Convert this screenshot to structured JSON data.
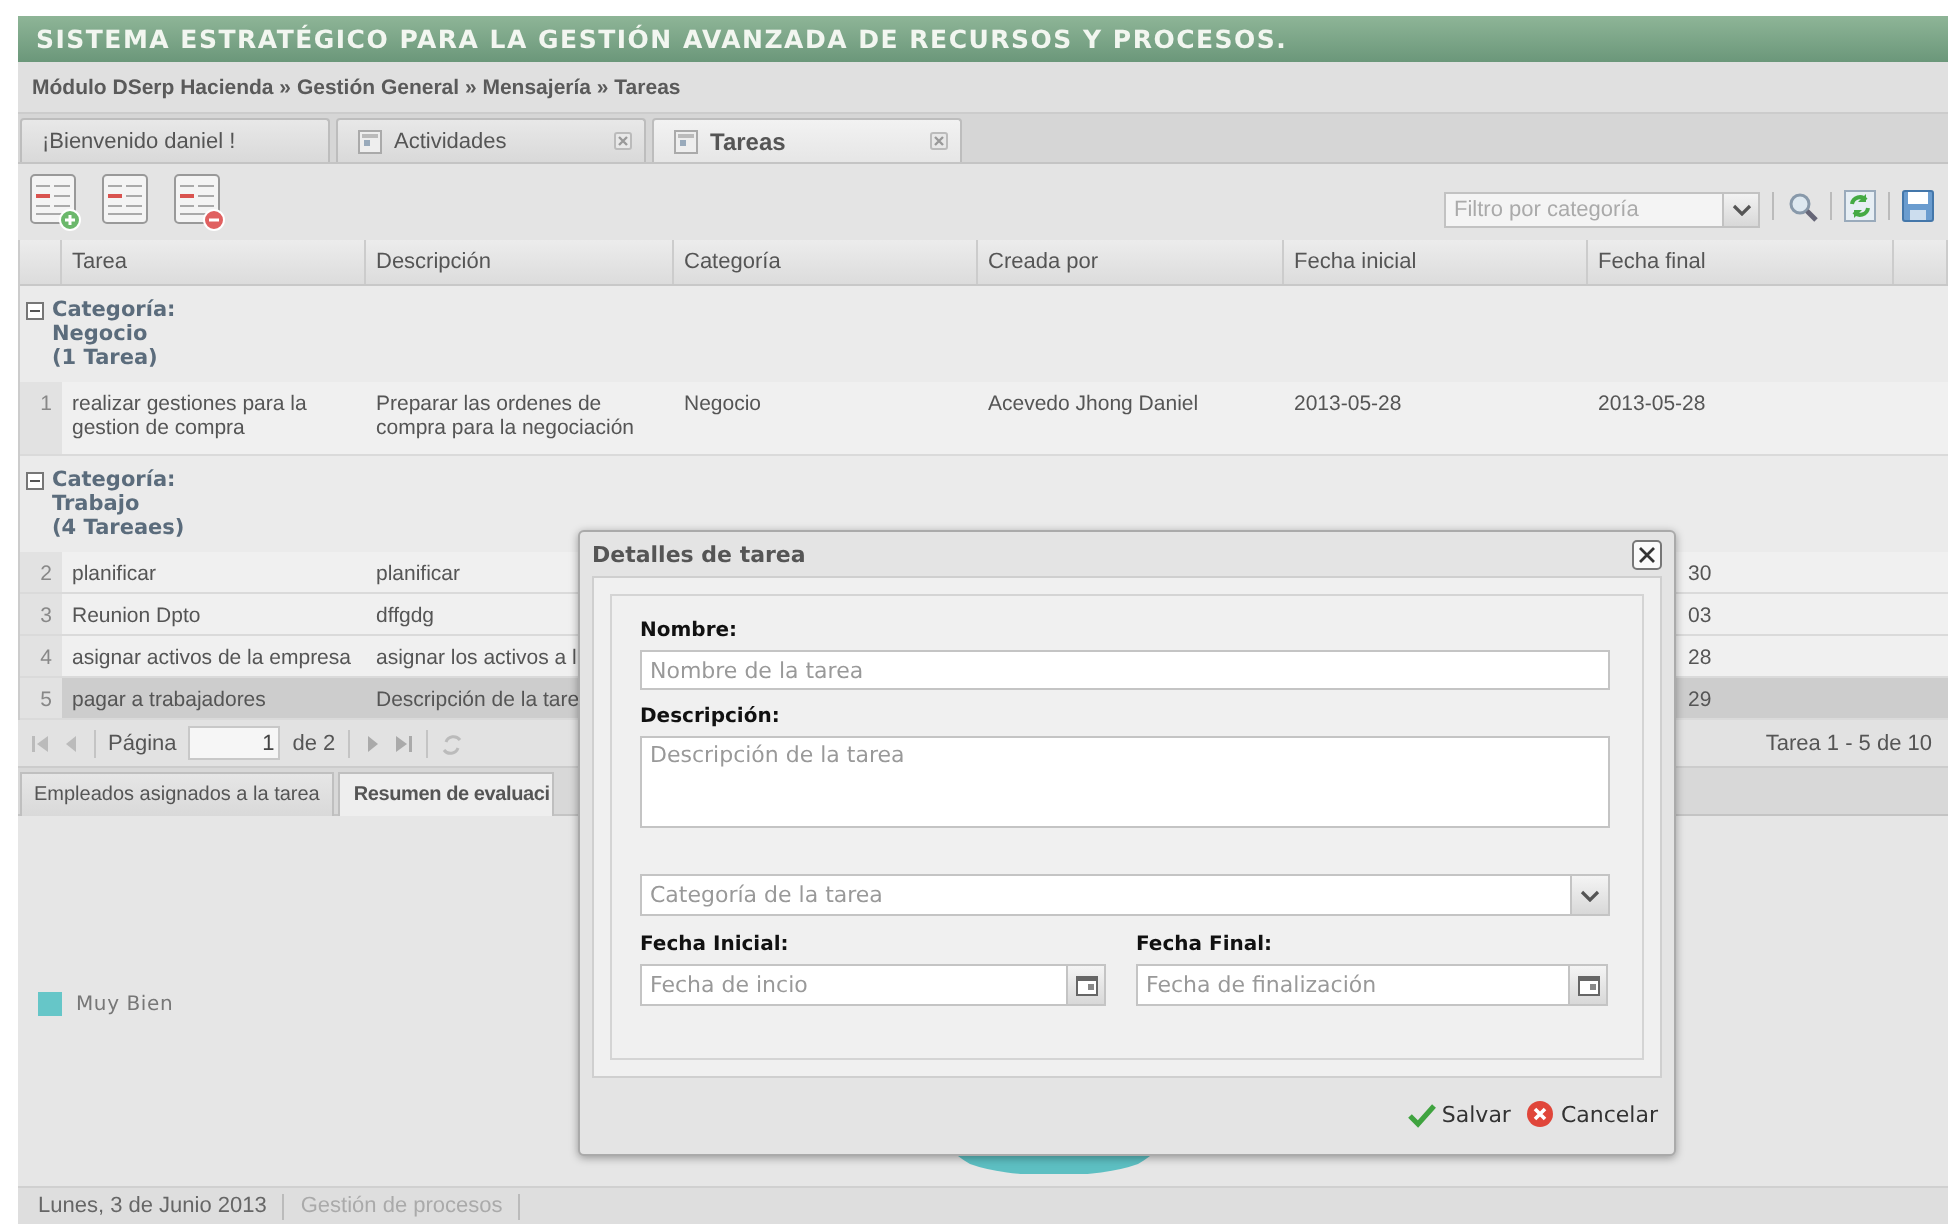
{
  "header": {
    "title": "SISTEMA ESTRATÉGICO PARA LA GESTIÓN AVANZADA DE RECURSOS Y PROCESOS."
  },
  "breadcrumb": "Módulo DSerp Hacienda » Gestión General » Mensajería » Tareas",
  "tabs": [
    {
      "label": "¡Bienvenido daniel !",
      "selected": false,
      "closable": false
    },
    {
      "label": "Actividades",
      "selected": false,
      "closable": true
    },
    {
      "label": "Tareas",
      "selected": true,
      "closable": true
    }
  ],
  "toolbar": {
    "filter": {
      "placeholder": "Filtro por categoría"
    }
  },
  "grid": {
    "columns": [
      "Tarea",
      "Descripción",
      "Categoría",
      "Creada por",
      "Fecha inicial",
      "Fecha final"
    ],
    "groups": [
      {
        "title": "Categoría:",
        "name": "Negocio",
        "count": "(1 Tarea)",
        "expanded": true,
        "rows": [
          {
            "number": "1",
            "selected": false,
            "tarea": "realizar gestiones para la gestion de compra",
            "descripcion": "Preparar las ordenes de compra para la negociación",
            "categoria": "Negocio",
            "creada_por": "Acevedo Jhong Daniel",
            "fecha_inicial": "2013-05-28",
            "fecha_final": "2013-05-28"
          }
        ]
      },
      {
        "title": "Categoría:",
        "name": "Trabajo",
        "count": "(4 Tareaes)",
        "expanded": true,
        "rows": [
          {
            "number": "2",
            "selected": false,
            "tarea": "planificar",
            "descripcion": "planificar",
            "fecha_final": "30"
          },
          {
            "number": "3",
            "selected": false,
            "tarea": "Reunion Dpto",
            "descripcion": "dffgdg",
            "fecha_final": "03"
          },
          {
            "number": "4",
            "selected": false,
            "tarea": "asignar activos de la empresa",
            "descripcion": "asignar los activos a l",
            "fecha_final": "28"
          },
          {
            "number": "5",
            "selected": true,
            "tarea": "pagar a trabajadores",
            "descripcion": "Descripción de la tare",
            "fecha_final": "29"
          }
        ]
      }
    ]
  },
  "pager": {
    "page_label": "Página",
    "page": "1",
    "of": "de 2",
    "summary": "Tarea 1 - 5 de 10"
  },
  "detail_tabs": [
    {
      "label": "Empleados asignados a la tarea",
      "selected": false
    },
    {
      "label": "Resumen de evaluaci",
      "selected": true
    }
  ],
  "chart": {
    "legend": [
      {
        "label": "Muy Bien",
        "color": "#66c6c8"
      }
    ]
  },
  "dialog": {
    "title": "Detalles de tarea",
    "fields": [
      {
        "kind": "text",
        "label": "Nombre:",
        "placeholder": "Nombre de la tarea"
      },
      {
        "kind": "textarea",
        "label": "Descripción:",
        "placeholder": "Descripción de la tarea"
      },
      {
        "kind": "combo",
        "placeholder": "Categoría de la tarea"
      }
    ],
    "dates": [
      {
        "label": "Fecha Inicial:",
        "placeholder": "Fecha de incio"
      },
      {
        "label": "Fecha Final:",
        "placeholder": "Fecha de finalización"
      }
    ],
    "buttons": [
      {
        "kind": "save",
        "label": "Salvar"
      },
      {
        "kind": "cancel",
        "label": "Cancelar"
      }
    ]
  },
  "status_bar": [
    "Lunes, 3 de Junio 2013",
    "Gestión de procesos"
  ]
}
